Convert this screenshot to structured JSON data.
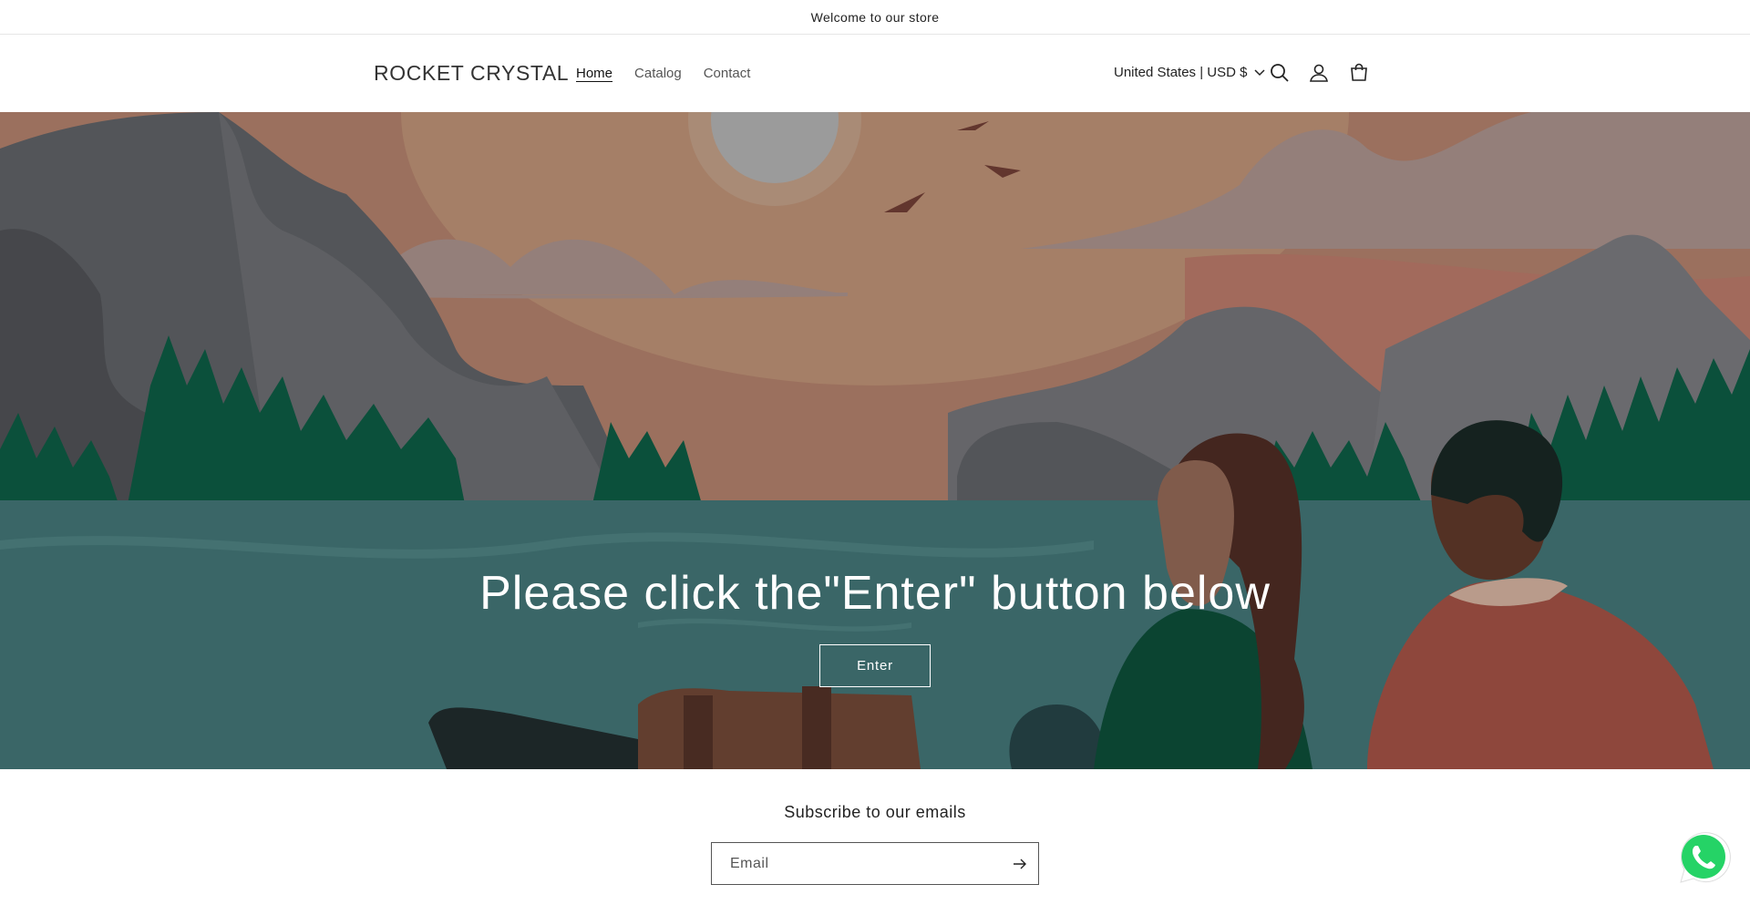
{
  "announcement": {
    "text": "Welcome to our store"
  },
  "header": {
    "logo": "ROCKET CRYSTAL",
    "nav": [
      {
        "label": "Home",
        "active": true
      },
      {
        "label": "Catalog",
        "active": false
      },
      {
        "label": "Contact",
        "active": false
      }
    ],
    "localization": "United States | USD $",
    "icons": [
      "search-icon",
      "account-icon",
      "cart-icon"
    ]
  },
  "hero": {
    "heading": "Please click the\"Enter\" button below",
    "button_label": "Enter"
  },
  "newsletter": {
    "title": "Subscribe to our emails",
    "email_placeholder": "Email"
  },
  "colors": {
    "sky": "#a97a66",
    "water": "#3f6f70",
    "mountain": "#5b5d61",
    "tree": "#0d5740",
    "whatsapp": "#25d366"
  }
}
